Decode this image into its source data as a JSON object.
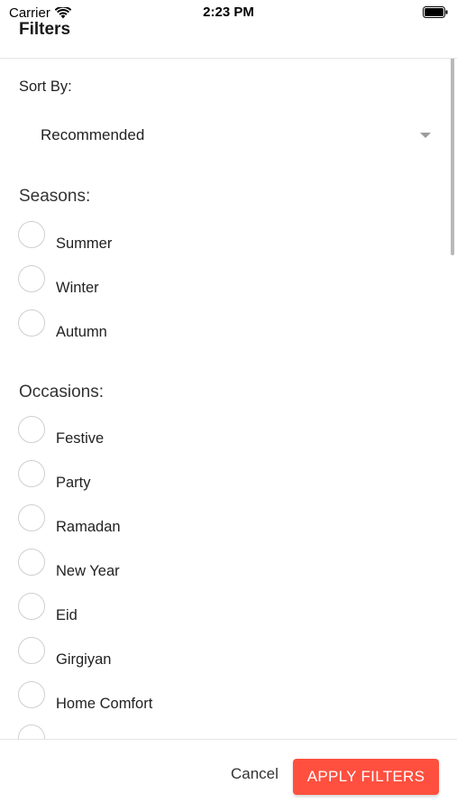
{
  "status_bar": {
    "carrier": "Carrier",
    "time": "2:23 PM",
    "icons": [
      "wifi-icon",
      "battery-icon"
    ]
  },
  "header": {
    "title": "Filters"
  },
  "sort": {
    "label": "Sort By:",
    "selected": "Recommended"
  },
  "seasons": {
    "label": "Seasons:",
    "options": [
      "Summer",
      "Winter",
      "Autumn"
    ]
  },
  "occasions": {
    "label": "Occasions:",
    "options": [
      "Festive",
      "Party",
      "Ramadan",
      "New Year",
      "Eid",
      "Girgiyan",
      "Home Comfort"
    ]
  },
  "footer": {
    "cancel_label": "Cancel",
    "apply_label": "APPLY FILTERS"
  },
  "colors": {
    "accent": "#ff4f3f",
    "radio_border": "#cfcfcf",
    "scrollbar": "#b9b9b9"
  }
}
